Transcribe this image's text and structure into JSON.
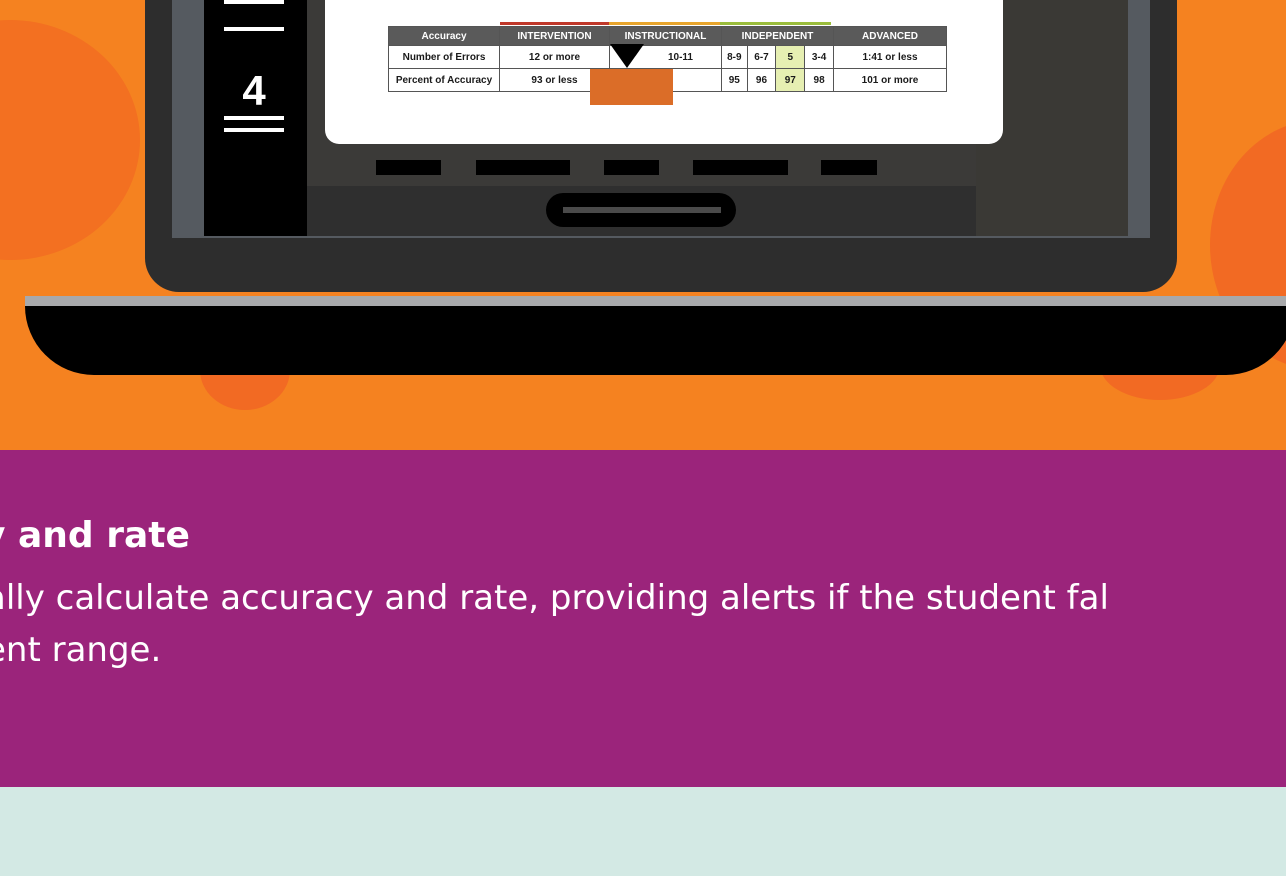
{
  "colors": {
    "hero_bg": "#f58220",
    "info_bg": "#9b247b",
    "footer_bg": "#d3e9e4",
    "highlight_cell": "#e6efb2",
    "orange_marker": "#db6d28"
  },
  "sidebar": {
    "step_number": "4"
  },
  "accuracy_table": {
    "headers": [
      "Accuracy",
      "INTERVENTION",
      "INSTRUCTIONAL",
      "INDEPENDENT",
      "ADVANCED"
    ],
    "errors_row": {
      "label": "Number of Errors",
      "intervention": "12 or more",
      "instructional": "10-11",
      "independent": [
        "8-9",
        "6-7",
        "5",
        "3-4"
      ],
      "advanced": "1:41 or less"
    },
    "accuracy_row": {
      "label": "Percent of Accuracy",
      "intervention": "93 or less",
      "instructional": "",
      "independent": [
        "95",
        "96",
        "97",
        "98"
      ],
      "advanced": "101 or more"
    }
  },
  "info": {
    "heading": "y and rate",
    "body_line1": "ally calculate accuracy and rate, providing alerts if the student fal",
    "body_line2": "ent range."
  }
}
